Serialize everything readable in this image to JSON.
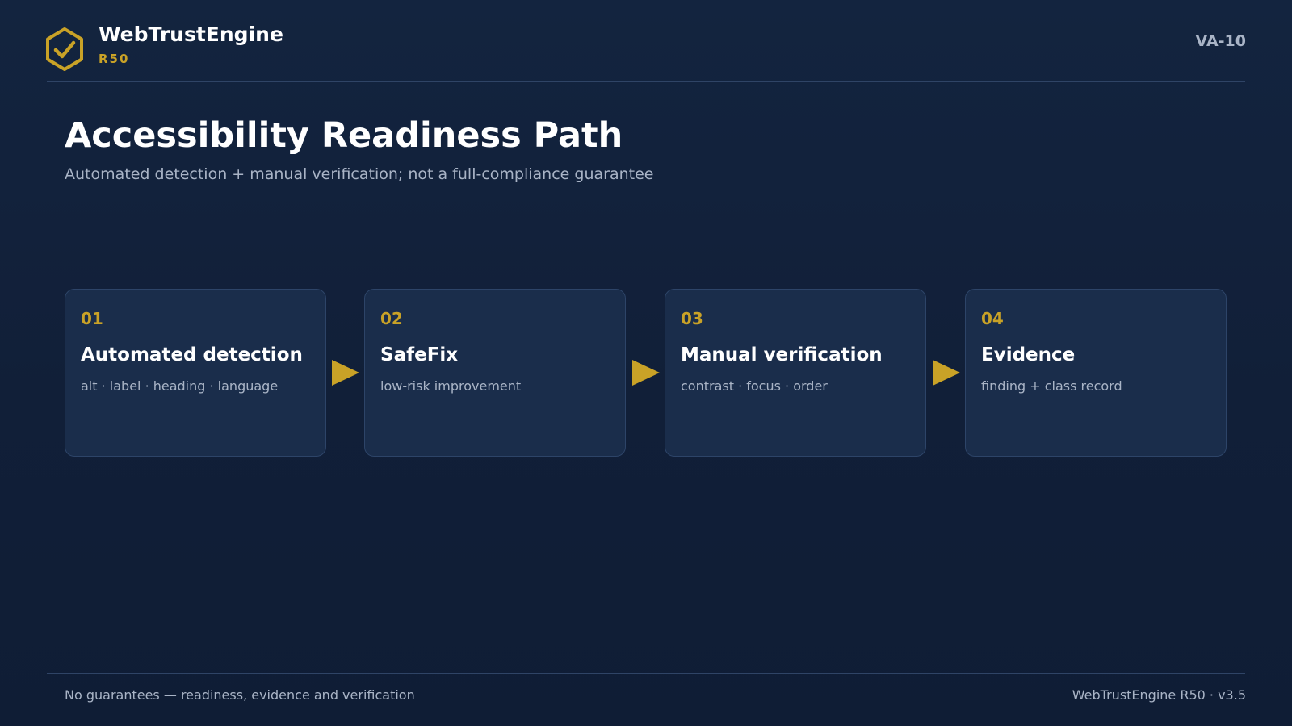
{
  "header": {
    "logo_icon": "hexagon-check-icon",
    "brand_name": "WebTrustEngine",
    "brand_sub": "R50",
    "slide_code": "VA-10"
  },
  "main": {
    "title": "Accessibility Readiness Path",
    "subtitle": "Automated detection + manual verification; not a full-compliance guarantee",
    "steps": [
      {
        "number": "01",
        "title": "Automated detection",
        "description": "alt · label · heading · language"
      },
      {
        "number": "02",
        "title": "SafeFix",
        "description": "low-risk improvement"
      },
      {
        "number": "03",
        "title": "Manual verification",
        "description": "contrast · focus · order"
      },
      {
        "number": "04",
        "title": "Evidence",
        "description": "finding + class record"
      }
    ],
    "connector_icon": "arrow-right-icon"
  },
  "footer": {
    "left": "No guarantees — readiness, evidence and verification",
    "right": "WebTrustEngine R50 · v3.5"
  },
  "colors": {
    "background": "#12233d",
    "card": "#1a2d4b",
    "accent": "#c9a227",
    "muted_text": "#a9b4c6"
  }
}
